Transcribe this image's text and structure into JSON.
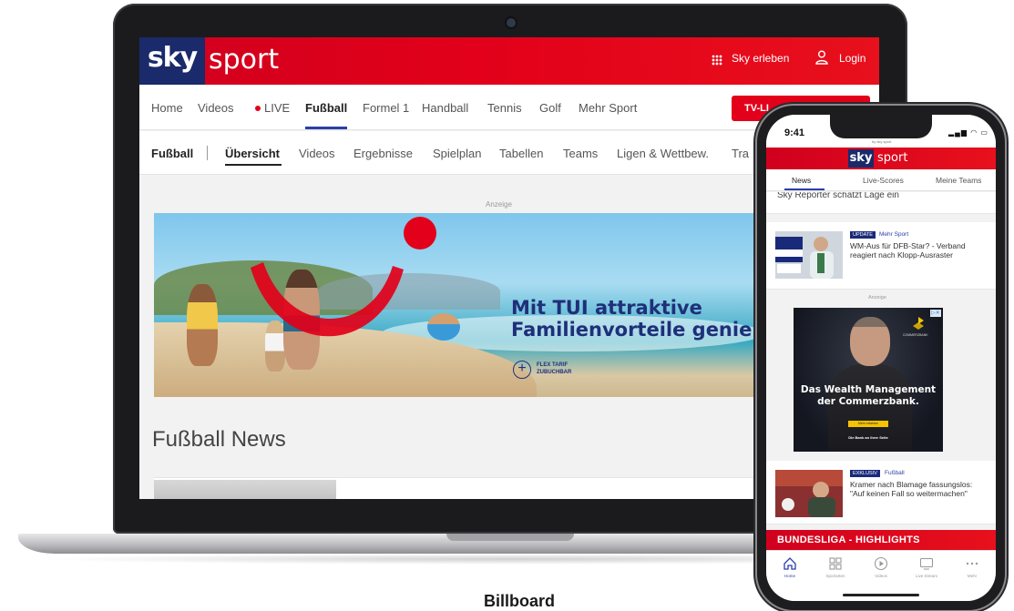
{
  "laptop": {
    "header": {
      "logo_sky": "sky",
      "logo_sport": "sport",
      "sky_erleben": "Sky erleben",
      "login": "Login"
    },
    "main_nav": {
      "items": [
        "Home",
        "Videos",
        "LIVE",
        "Fußball",
        "Formel 1",
        "Handball",
        "Tennis",
        "Golf",
        "Mehr Sport"
      ],
      "active": "Fußball",
      "tv_button": "TV-LI"
    },
    "sub_nav": {
      "section": "Fußball",
      "items": [
        "Übersicht",
        "Videos",
        "Ergebnisse",
        "Spielplan",
        "Tabellen",
        "Teams",
        "Ligen & Wettbew.",
        "Tra"
      ],
      "active": "Übersicht"
    },
    "ad_label": "Anzeige",
    "banner": {
      "headline_1": "Mit TUI attraktive",
      "headline_2": "Familienvorteile genie",
      "flex_text": "FLEX TARIF ZUBUCHBAR"
    },
    "news_heading": "Fußball News"
  },
  "phone": {
    "time": "9:41",
    "by_text": "by sky sport",
    "logo_sky": "sky",
    "logo_sport": "sport",
    "tabs": [
      "News",
      "Live-Scores",
      "Meine Teams"
    ],
    "active_tab": "News",
    "cut_text": "Sky Reporter schätzt Lage ein",
    "articles": [
      {
        "badge": "UPDATE",
        "category": "Mehr Sport",
        "headline": "WM-Aus für DFB-Star? - Verband reagiert nach Klopp-Ausraster"
      },
      {
        "badge": "EXKLUSIV",
        "category": "Fußball",
        "headline": "Kramer nach Blamage fassungslos: \"Auf keinen Fall so weitermachen\""
      }
    ],
    "ad_label": "Anzeige",
    "ad": {
      "title": "Das Wealth Management der Commerzbank.",
      "brand": "COMMERZBANK",
      "button": "Mehr erfahren",
      "slogan": "Die Bank an Ihrer Seite"
    },
    "highlights": "BUNDESLIGA - HIGHLIGHTS",
    "bottom_nav": [
      {
        "label": "Home",
        "icon": "home-icon"
      },
      {
        "label": "Sportarten",
        "icon": "grid-icon"
      },
      {
        "label": "Videos",
        "icon": "play-icon"
      },
      {
        "label": "Live Stream",
        "icon": "tv-icon"
      },
      {
        "label": "Mehr",
        "icon": "more-icon"
      }
    ]
  },
  "caption": "Billboard",
  "colors": {
    "sky_red": "#e2001a",
    "sky_blue": "#1a2a6a",
    "nav_accent": "#2b3ea8"
  }
}
